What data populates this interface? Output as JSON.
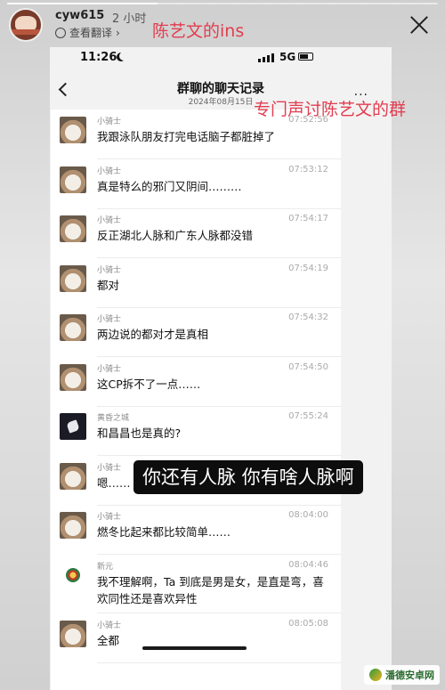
{
  "story": {
    "progress": 0.35,
    "username": "cyw615",
    "time_ago": "2 小时",
    "translate_label": "查看翻译",
    "caption_top": "陈艺文的ins",
    "caption_right": "专门声讨陈艺文的群"
  },
  "phone": {
    "status_time": "11:26",
    "network": "5G",
    "nav_title": "群聊的聊天记录",
    "nav_date": "2024年08月15日",
    "more_label": "···"
  },
  "messages": [
    {
      "name": "小骑士",
      "time": "07:52:56",
      "text": "我跟泳队朋友打完电话脑子都脏掉了",
      "avatar": "dog"
    },
    {
      "name": "小骑士",
      "time": "07:53:12",
      "text": "真是特么的邪门又阴间………",
      "avatar": "dog"
    },
    {
      "name": "小骑士",
      "time": "07:54:17",
      "text": "反正湖北人脉和广东人脉都没错",
      "avatar": "dog"
    },
    {
      "name": "小骑士",
      "time": "07:54:19",
      "text": "都对",
      "avatar": "dog"
    },
    {
      "name": "小骑士",
      "time": "07:54:32",
      "text": "两边说的都对才是真相",
      "avatar": "dog"
    },
    {
      "name": "小骑士",
      "time": "07:54:50",
      "text": "这CP拆不了一点……",
      "avatar": "dog"
    },
    {
      "name": "黄昏之城",
      "time": "07:55:24",
      "text": "和昌昌也是真的?",
      "avatar": "dark"
    },
    {
      "name": "小骑士",
      "time": "",
      "text": "嗯……",
      "avatar": "dog"
    },
    {
      "name": "小骑士",
      "time": "08:04:00",
      "text": "燃冬比起来都比较简单……",
      "avatar": "dog"
    },
    {
      "name": "新元",
      "time": "08:04:46",
      "text": "我不理解啊，Ta 到底是男是女，是直是弯，喜欢同性还是喜欢异性",
      "avatar": "flower"
    },
    {
      "name": "小骑士",
      "time": "08:05:08",
      "text": "全都",
      "avatar": "dog"
    }
  ],
  "overlay_caption": "你还有人脉 你有啥人脉啊",
  "watermark": "潘德安卓网",
  "icons": [
    "globe-icon",
    "close-icon",
    "back-icon",
    "more-icon",
    "moon-icon",
    "signal-icon",
    "battery-icon"
  ]
}
